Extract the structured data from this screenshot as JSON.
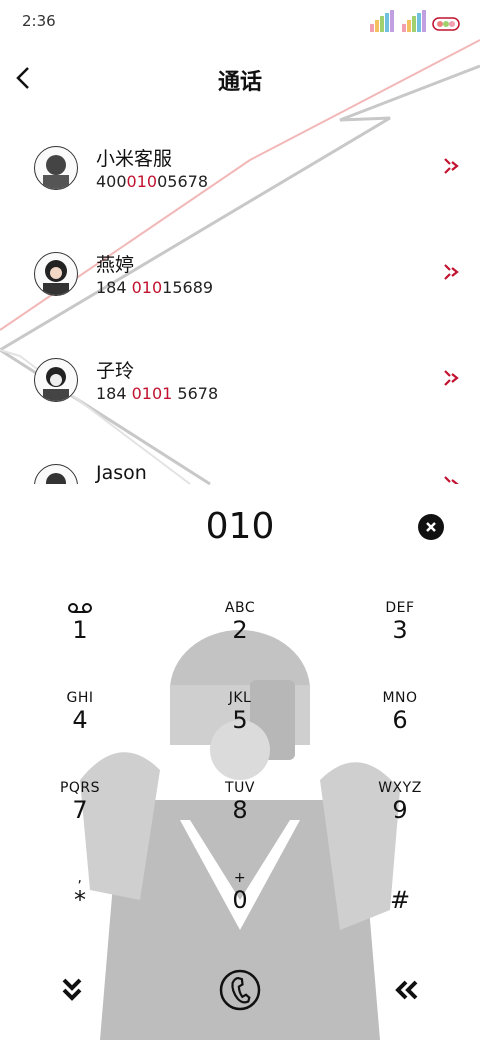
{
  "status_bar": {
    "time": "2:36"
  },
  "header": {
    "title": "通话"
  },
  "contacts": [
    {
      "name": "小米客服",
      "number_pre": "400",
      "number_hl": "010",
      "number_post": "05678"
    },
    {
      "name": "燕婷",
      "number_pre": "184 ",
      "number_hl": "010",
      "number_post": "15689"
    },
    {
      "name": "子玲",
      "number_pre": "184 ",
      "number_hl": "0101",
      "number_post": " 5678"
    },
    {
      "name": "Jason",
      "number_pre": "",
      "number_hl": "",
      "number_post": ""
    }
  ],
  "dialer": {
    "number": "010"
  },
  "keypad": [
    {
      "letters": "",
      "digit": "1",
      "icon": "voicemail-icon"
    },
    {
      "letters": "ABC",
      "digit": "2"
    },
    {
      "letters": "DEF",
      "digit": "3"
    },
    {
      "letters": "GHI",
      "digit": "4"
    },
    {
      "letters": "JKL",
      "digit": "5"
    },
    {
      "letters": "MNO",
      "digit": "6"
    },
    {
      "letters": "PQRS",
      "digit": "7"
    },
    {
      "letters": "TUV",
      "digit": "8"
    },
    {
      "letters": "WXYZ",
      "digit": "9"
    },
    {
      "letters": ",",
      "digit": "*"
    },
    {
      "letters": "+",
      "digit": "0"
    },
    {
      "letters": "",
      "digit": "#"
    }
  ],
  "colors": {
    "accent": "#c1122f"
  }
}
